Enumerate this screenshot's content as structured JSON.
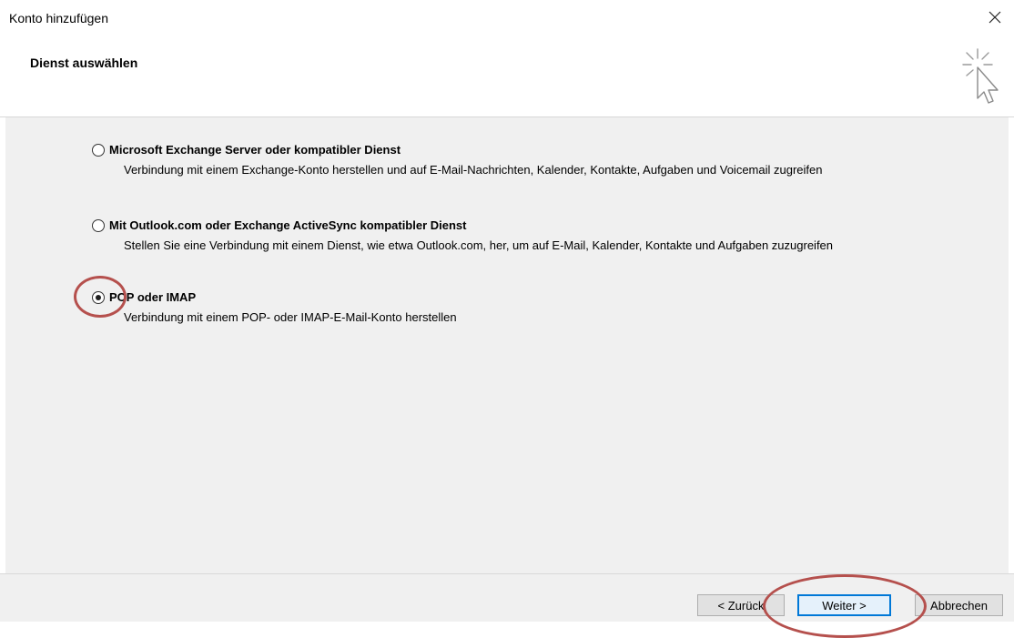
{
  "window": {
    "title": "Konto hinzufügen"
  },
  "header": {
    "title": "Dienst auswählen"
  },
  "options": [
    {
      "label": "Microsoft Exchange Server oder kompatibler Dienst",
      "description": "Verbindung mit einem Exchange-Konto herstellen und auf E-Mail-Nachrichten, Kalender, Kontakte, Aufgaben und Voicemail zugreifen",
      "selected": false
    },
    {
      "label": "Mit Outlook.com oder Exchange ActiveSync kompatibler Dienst",
      "description": "Stellen Sie eine Verbindung mit einem Dienst, wie etwa Outlook.com, her, um auf E-Mail, Kalender, Kontakte und Aufgaben zuzugreifen",
      "selected": false
    },
    {
      "label": "POP oder IMAP",
      "description": "Verbindung mit einem POP- oder IMAP-E-Mail-Konto herstellen",
      "selected": true
    }
  ],
  "footer": {
    "back_label": "< Zurück",
    "next_label": "Weiter >",
    "cancel_label": "Abbrechen"
  },
  "icons": {
    "close": "close-icon",
    "wizard": "cursor-sparkle-icon"
  },
  "colors": {
    "content_bg": "#f0f0f0",
    "annotation": "#b5504d",
    "default_button_border": "#0078d7"
  }
}
